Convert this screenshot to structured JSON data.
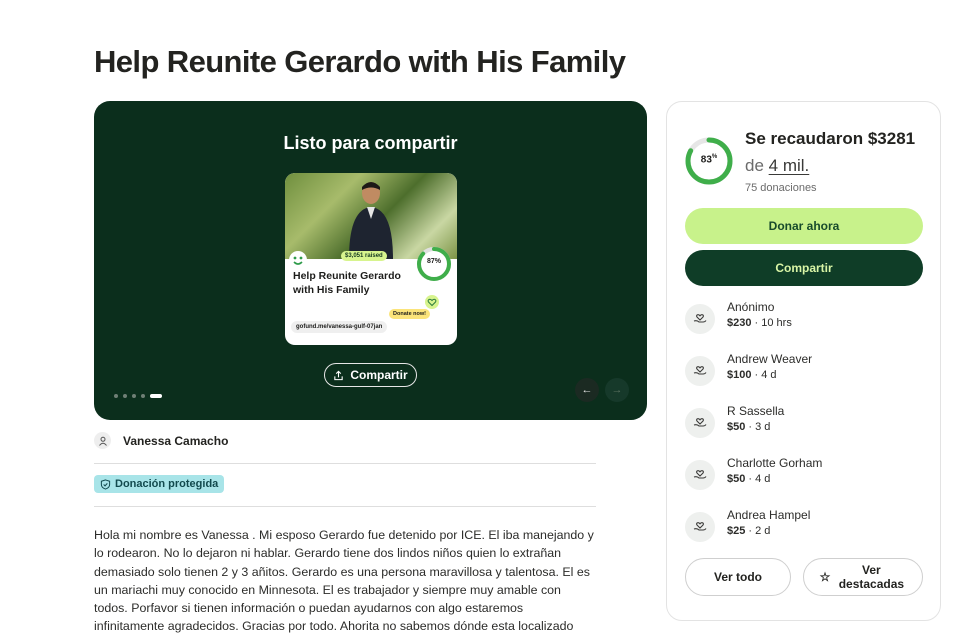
{
  "page": {
    "title": "Help Reunite Gerardo with His Family"
  },
  "hero": {
    "heading": "Listo para compartir",
    "share_label": "Compartir",
    "slides": 5,
    "active_slide": 5,
    "card": {
      "raised_tag": "$3,051 raised",
      "percent": "87%",
      "progress": 0.87,
      "headline": "Help Reunite Gerardo with His Family",
      "donate_tag": "Donate now!",
      "url": "gofund.me/vanessa-gulf-07jan"
    }
  },
  "organizer": {
    "name": "Vanessa Camacho"
  },
  "badge": {
    "label": "Donación protegida"
  },
  "story": "Hola mi nombre es Vanessa . Mi esposo Gerardo fue detenido por ICE. El iba manejando y lo rodearon. No lo dejaron ni hablar. Gerardo tiene dos lindos niños quien lo extrañan demasiado solo tienen 2 y 3 añitos. Gerardo es una persona maravillosa y talentosa. El es un mariachi muy conocido en Minnesota. El es trabajador y siempre muy amable con todos. Porfavor si tienen información o puedan ayudarnos con algo estaremos infinitamente agradecidos. Gracias por todo. Ahorita no sabemos dónde esta localizado",
  "summary": {
    "percent": "83",
    "percent_suffix": "%",
    "progress": 0.83,
    "raised_text": "Se recaudaron $3281",
    "goal_prefix": "de ",
    "goal_amount": "4 mil.",
    "donations_count": "75 donaciones",
    "donate_label": "Donar ahora",
    "share_label": "Compartir"
  },
  "donations": [
    {
      "name": "Anónimo",
      "amount": "$230",
      "time": " · 10 hrs"
    },
    {
      "name": "Andrew Weaver",
      "amount": "$100",
      "time": " · 4 d"
    },
    {
      "name": "R Sassella",
      "amount": "$50",
      "time": " · 3 d"
    },
    {
      "name": "Charlotte Gorham",
      "amount": "$50",
      "time": " · 4 d"
    },
    {
      "name": "Andrea Hampel",
      "amount": "$25",
      "time": " · 2 d"
    }
  ],
  "actions": {
    "see_all": "Ver todo",
    "see_top": "Ver destacadas"
  },
  "colors": {
    "hero_bg": "#0b2e1c",
    "accent_green": "#c8f28b",
    "dark_green": "#0f3d27",
    "ring_green": "#3fae4a",
    "badge_bg": "#a8e4e8"
  },
  "icons": [
    "share-icon",
    "arrow-left-icon",
    "arrow-right-icon",
    "user-icon",
    "shield-icon",
    "heart-hand-icon",
    "star-icon"
  ]
}
